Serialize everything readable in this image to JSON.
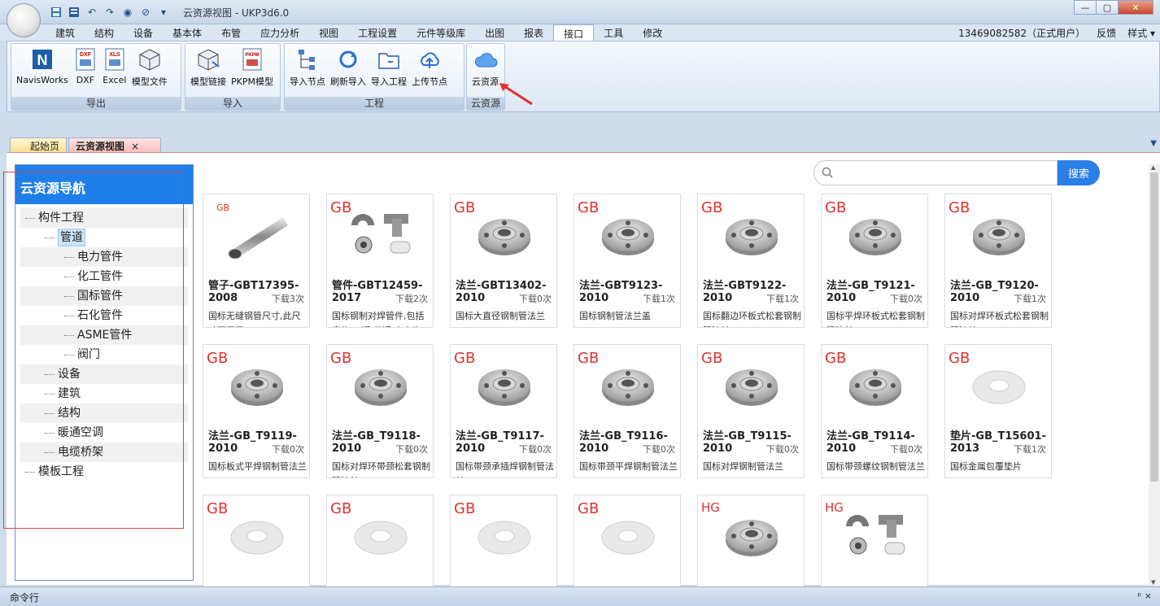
{
  "window": {
    "title": "云资源视图 - UKP3d6.0",
    "controls": [
      "—",
      "▢",
      "✕"
    ]
  },
  "menu": {
    "tabs": [
      "建筑",
      "结构",
      "设备",
      "基本体",
      "布管",
      "应力分析",
      "视图",
      "工程设置",
      "元件等级库",
      "出图",
      "报表",
      "接口",
      "工具",
      "修改"
    ],
    "active": "接口",
    "user": "13469082582（正式用户）",
    "feedback": "反馈",
    "style": "样式"
  },
  "ribbon": {
    "groups": [
      {
        "label": "导出",
        "tools": [
          "NavisWorks",
          "DXF",
          "Excel",
          "模型文件"
        ]
      },
      {
        "label": "导入",
        "tools": [
          "模型链接",
          "PKPM模型"
        ]
      },
      {
        "label": "工程",
        "tools": [
          "导入节点",
          "刷新导入",
          "导入工程",
          "上传节点"
        ]
      },
      {
        "label": "云资源",
        "tools": [
          "云资源"
        ]
      }
    ],
    "icon_text": {
      "dxf": "DXF",
      "xls": "XLS",
      "pkpm": "PKPM"
    }
  },
  "doc_tabs": [
    {
      "label": "起始页"
    },
    {
      "label": "云资源视图",
      "close": "×"
    }
  ],
  "sidebar": {
    "title": "云资源导航",
    "tree": [
      {
        "label": "构件工程",
        "level": 0
      },
      {
        "label": "管道",
        "level": 1,
        "selected": true
      },
      {
        "label": "电力管件",
        "level": 2
      },
      {
        "label": "化工管件",
        "level": 2
      },
      {
        "label": "国标管件",
        "level": 2
      },
      {
        "label": "石化管件",
        "level": 2
      },
      {
        "label": "ASME管件",
        "level": 2
      },
      {
        "label": "阀门",
        "level": 2
      },
      {
        "label": "设备",
        "level": 1
      },
      {
        "label": "建筑",
        "level": 1
      },
      {
        "label": "结构",
        "level": 1
      },
      {
        "label": "暖通空调",
        "level": 1
      },
      {
        "label": "电缆桥架",
        "level": 1
      },
      {
        "label": "模板工程",
        "level": 0
      }
    ]
  },
  "search": {
    "placeholder": "",
    "button": "搜索"
  },
  "cards": [
    {
      "std": "GB",
      "name": "管子-GBT17395-2008",
      "downloads": "下载3次",
      "desc": "国标无缝钢管尺寸,此尺寸可用于",
      "img": "pipe"
    },
    {
      "std": "GB",
      "name": "管件-GBT12459-2017",
      "downloads": "下载2次",
      "desc": "国标钢制对焊管件,包括弯头,三通,四通,大小头,",
      "img": "fittings"
    },
    {
      "std": "GB",
      "name": "法兰-GBT13402-2010",
      "downloads": "下载0次",
      "desc": "国标大直径钢制管法兰",
      "img": "flange"
    },
    {
      "std": "GB",
      "name": "法兰-GBT9123-2010",
      "downloads": "下载1次",
      "desc": "国标钢制管法兰盖",
      "img": "flange"
    },
    {
      "std": "GB",
      "name": "法兰-GBT9122-2010",
      "downloads": "下载1次",
      "desc": "国标翻边环板式松套钢制管法兰",
      "img": "flange"
    },
    {
      "std": "GB",
      "name": "法兰-GB_T9121-2010",
      "downloads": "下载0次",
      "desc": "国标平焊环板式松套钢制管法兰",
      "img": "flange"
    },
    {
      "std": "GB",
      "name": "法兰-GB_T9120-2010",
      "downloads": "下载1次",
      "desc": "国标对焊环板式松套钢制管法兰",
      "img": "flange"
    },
    {
      "std": "GB",
      "name": "法兰-GB_T9119-2010",
      "downloads": "下载0次",
      "desc": "国标板式平焊钢制管法兰",
      "img": "flange"
    },
    {
      "std": "GB",
      "name": "法兰-GB_T9118-2010",
      "downloads": "下载0次",
      "desc": "国标对焊环带颈松套钢制管法兰",
      "img": "flange"
    },
    {
      "std": "GB",
      "name": "法兰-GB_T9117-2010",
      "downloads": "下载0次",
      "desc": "国标带颈承插焊钢制管法兰",
      "img": "flange"
    },
    {
      "std": "GB",
      "name": "法兰-GB_T9116-2010",
      "downloads": "下载0次",
      "desc": "国标带颈平焊钢制管法兰",
      "img": "flange"
    },
    {
      "std": "GB",
      "name": "法兰-GB_T9115-2010",
      "downloads": "下载0次",
      "desc": "国标对焊钢制管法兰",
      "img": "flange"
    },
    {
      "std": "GB",
      "name": "法兰-GB_T9114-2010",
      "downloads": "下载0次",
      "desc": "国标带颈螺纹钢制管法兰",
      "img": "flange"
    },
    {
      "std": "GB",
      "name": "垫片-GB_T15601-2013",
      "downloads": "下载1次",
      "desc": "国标金属包覆垫片",
      "img": "gasket"
    },
    {
      "std": "GB",
      "name": "",
      "downloads": "",
      "desc": "",
      "img": "gasket"
    },
    {
      "std": "GB",
      "name": "",
      "downloads": "",
      "desc": "",
      "img": "gasket"
    },
    {
      "std": "GB",
      "name": "",
      "downloads": "",
      "desc": "",
      "img": "gasket"
    },
    {
      "std": "GB",
      "name": "",
      "downloads": "",
      "desc": "",
      "img": "gasket"
    },
    {
      "std": "HG",
      "name": "",
      "downloads": "",
      "desc": "",
      "img": "flange"
    },
    {
      "std": "HG",
      "name": "",
      "downloads": "",
      "desc": "",
      "img": "fittings"
    }
  ],
  "command_bar": {
    "label": "命令行",
    "pin": "ᵖ ×"
  },
  "colors": {
    "accent": "#1f7fe8",
    "std_label": "#e0322f",
    "highlight": "#e04040"
  }
}
